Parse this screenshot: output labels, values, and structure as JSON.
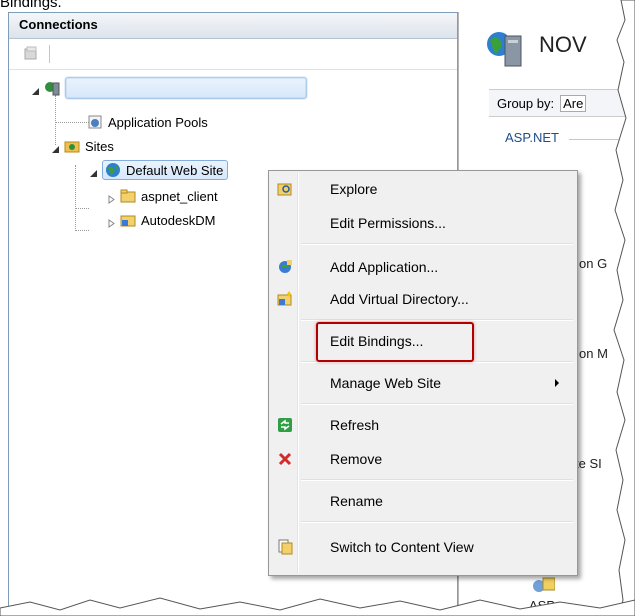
{
  "caption": "Bindings.",
  "connections": {
    "title": "Connections",
    "tree": {
      "server_label": "",
      "app_pools": "Application Pools",
      "sites": "Sites",
      "default_site": "Default Web Site",
      "child1": "aspnet_client",
      "child2": "AutodeskDM"
    }
  },
  "right": {
    "title": "NOV",
    "groupby_label": "Group by:",
    "groupby_value": "Are",
    "asp_label": "ASP.NET",
    "frag1": "on  G",
    "frag2": "on  M",
    "frag3": "te  SI",
    "bottom_label": "ASP"
  },
  "context_menu": {
    "items": [
      {
        "label": "Explore",
        "icon": "explore-icon"
      },
      {
        "label": "Edit Permissions...",
        "icon": ""
      },
      {
        "label": "Add Application...",
        "icon": "add-application-icon"
      },
      {
        "label": "Add Virtual Directory...",
        "icon": "add-virtual-directory-icon"
      },
      {
        "label": "Edit Bindings...",
        "icon": ""
      },
      {
        "label": "Manage Web Site",
        "icon": "",
        "submenu": true
      },
      {
        "label": "Refresh",
        "icon": "refresh-icon"
      },
      {
        "label": "Remove",
        "icon": "remove-icon"
      },
      {
        "label": "Rename",
        "icon": ""
      },
      {
        "label": "Switch to Content View",
        "icon": "content-view-icon"
      }
    ]
  },
  "colors": {
    "highlight": "#b00000",
    "link_blue": "#1e4e8c"
  }
}
